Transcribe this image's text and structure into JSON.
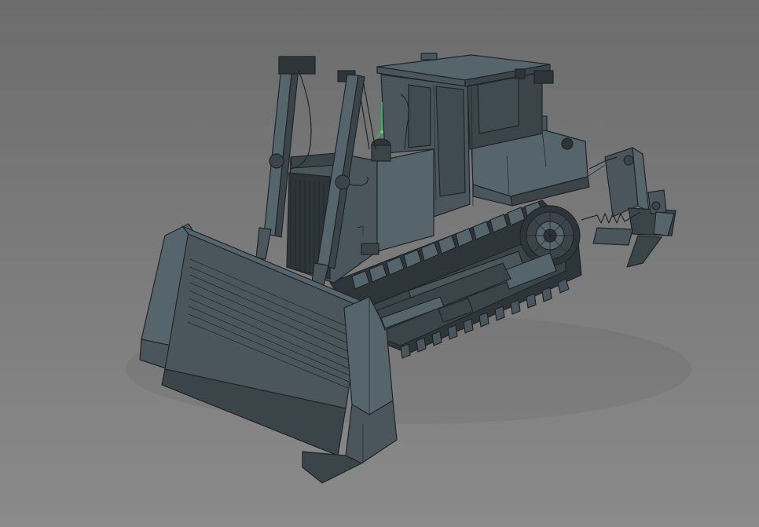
{
  "viewport": {
    "background_top": "#6c6c6c",
    "background_bottom": "#8a8a8a",
    "model_color": "#4a565c",
    "wireframe_color": "#1f2529",
    "gizmo_y_axis_color": "#22c55e"
  }
}
